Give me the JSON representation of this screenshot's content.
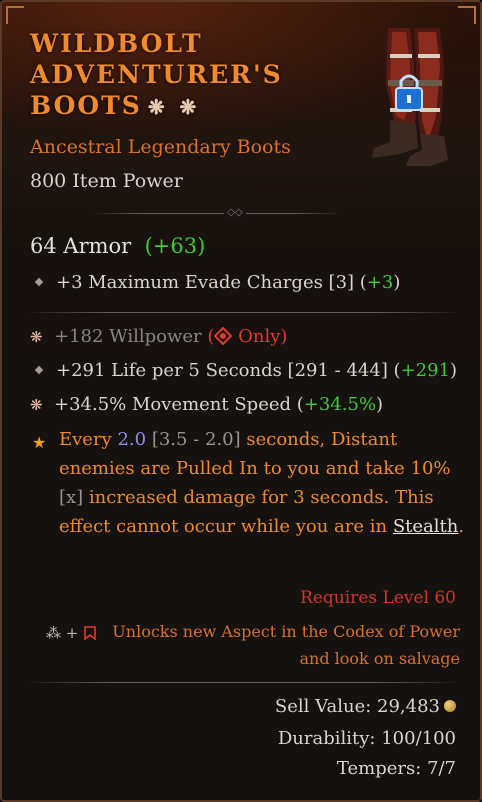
{
  "item": {
    "name": "WILDBOLT ADVENTURER'S BOOTS",
    "title_icons": "❋ ❋",
    "rarity_type": "Ancestral Legendary Boots",
    "item_power": "800 Item Power",
    "armor_label": "64 Armor",
    "armor_bonus": "(+63)",
    "image_icon": "boots-with-lock-icon"
  },
  "implicit": {
    "text": "+3 Maximum Evade Charges [3] (",
    "bonus": "+3",
    "close": ")"
  },
  "affixes": [
    {
      "icon": "star-affix-icon",
      "text": "+182 Willpower",
      "suffix_open": " (",
      "class_icon": "druid-class-icon",
      "suffix": " Only)"
    },
    {
      "icon": "diamond-affix-icon",
      "text": "+291 Life per 5 Seconds [291 - 444] (",
      "bonus": "+291",
      "close": ")"
    },
    {
      "icon": "star-affix-icon",
      "text": "+34.5% Movement Speed (",
      "bonus": "+34.5%",
      "close": ")"
    }
  ],
  "aspect": {
    "icon": "legendary-star-icon",
    "p1": "Every ",
    "value": "2.0",
    "range": " [3.5 - 2.0]",
    "p2": " seconds, Distant enemies are Pulled In to you and take 10% ",
    "x": "[x]",
    "p3": " increased damage for 3 seconds. This effect cannot occur while you are in ",
    "keyword": "Stealth",
    "p4": "."
  },
  "requirements": {
    "level": "Requires Level 60",
    "unlock_prefix": "+",
    "unlock_text": "Unlocks new Aspect in the Codex of Power and look on salvage"
  },
  "footer": {
    "sell_value": "Sell Value: 29,483",
    "durability": "Durability: 100/100",
    "tempers": "Tempers: 7/7"
  },
  "colors": {
    "legendary_orange": "#f08a2c",
    "bonus_green": "#42c93b",
    "requirement_red": "#d4342a",
    "aspect_value_blue": "#8e8cf0"
  }
}
